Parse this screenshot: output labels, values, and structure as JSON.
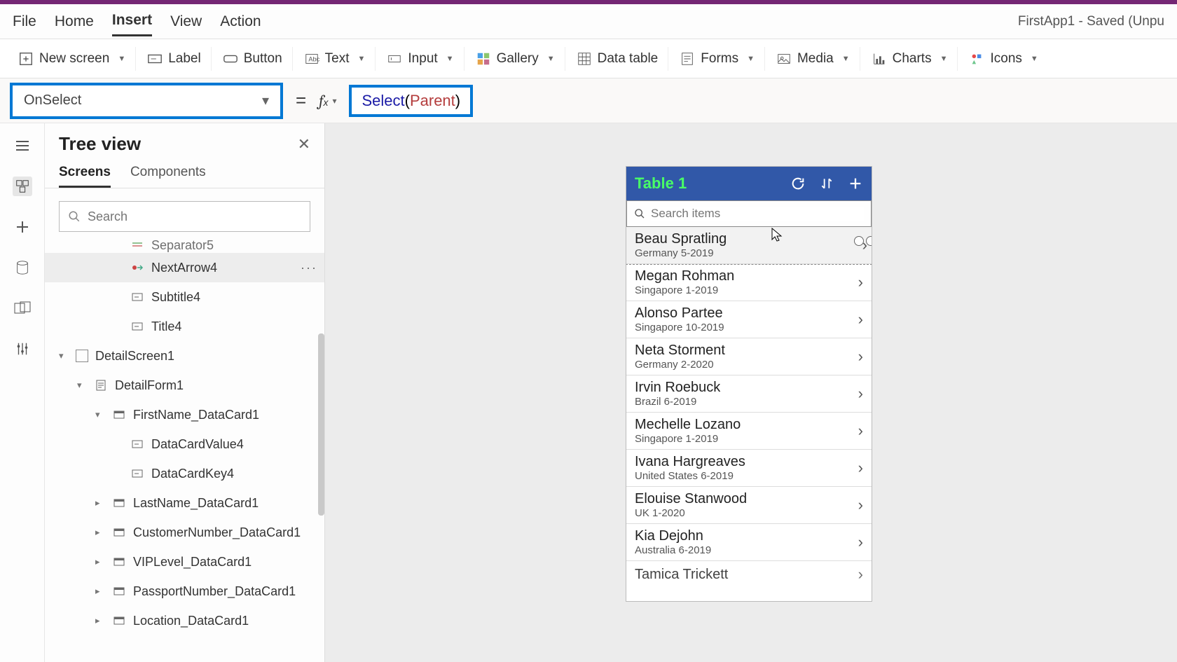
{
  "app_title": "FirstApp1 - Saved (Unpu",
  "menu": [
    "File",
    "Home",
    "Insert",
    "View",
    "Action"
  ],
  "active_menu": "Insert",
  "ribbon": [
    {
      "label": "New screen",
      "icon": "new-screen",
      "chevron": true
    },
    {
      "label": "Label",
      "icon": "label",
      "chevron": false
    },
    {
      "label": "Button",
      "icon": "button",
      "chevron": false
    },
    {
      "label": "Text",
      "icon": "text",
      "chevron": true
    },
    {
      "label": "Input",
      "icon": "input",
      "chevron": true
    },
    {
      "label": "Gallery",
      "icon": "gallery",
      "chevron": true
    },
    {
      "label": "Data table",
      "icon": "data-table",
      "chevron": false
    },
    {
      "label": "Forms",
      "icon": "forms",
      "chevron": true
    },
    {
      "label": "Media",
      "icon": "media",
      "chevron": true
    },
    {
      "label": "Charts",
      "icon": "charts",
      "chevron": true
    },
    {
      "label": "Icons",
      "icon": "icons",
      "chevron": true
    }
  ],
  "property_dropdown": "OnSelect",
  "formula": {
    "fn": "Select",
    "arg": "Parent"
  },
  "tree": {
    "title": "Tree view",
    "tabs": [
      "Screens",
      "Components"
    ],
    "active_tab": "Screens",
    "search_placeholder": "Search",
    "items": [
      {
        "depth": 3,
        "label": "Separator5",
        "expander": "",
        "icon": "sep",
        "selected": false,
        "cutoff": true
      },
      {
        "depth": 3,
        "label": "NextArrow4",
        "expander": "",
        "icon": "arrow",
        "selected": true,
        "more": true
      },
      {
        "depth": 3,
        "label": "Subtitle4",
        "expander": "",
        "icon": "label",
        "selected": false
      },
      {
        "depth": 3,
        "label": "Title4",
        "expander": "",
        "icon": "label",
        "selected": false
      },
      {
        "depth": 0,
        "label": "DetailScreen1",
        "expander": "▾",
        "icon": "screen",
        "selected": false
      },
      {
        "depth": 1,
        "label": "DetailForm1",
        "expander": "▾",
        "icon": "form",
        "selected": false
      },
      {
        "depth": 2,
        "label": "FirstName_DataCard1",
        "expander": "▾",
        "icon": "card",
        "selected": false
      },
      {
        "depth": 3,
        "label": "DataCardValue4",
        "expander": "",
        "icon": "label",
        "selected": false
      },
      {
        "depth": 3,
        "label": "DataCardKey4",
        "expander": "",
        "icon": "label",
        "selected": false
      },
      {
        "depth": 2,
        "label": "LastName_DataCard1",
        "expander": "▸",
        "icon": "card",
        "selected": false
      },
      {
        "depth": 2,
        "label": "CustomerNumber_DataCard1",
        "expander": "▸",
        "icon": "card",
        "selected": false
      },
      {
        "depth": 2,
        "label": "VIPLevel_DataCard1",
        "expander": "▸",
        "icon": "card",
        "selected": false
      },
      {
        "depth": 2,
        "label": "PassportNumber_DataCard1",
        "expander": "▸",
        "icon": "card",
        "selected": false
      },
      {
        "depth": 2,
        "label": "Location_DataCard1",
        "expander": "▸",
        "icon": "card",
        "selected": false
      }
    ]
  },
  "phone": {
    "title": "Table 1",
    "search_placeholder": "Search items",
    "items": [
      {
        "name": "Beau Spratling",
        "sub": "Germany 5-2019",
        "selected": true
      },
      {
        "name": "Megan Rohman",
        "sub": "Singapore 1-2019"
      },
      {
        "name": "Alonso Partee",
        "sub": "Singapore 10-2019"
      },
      {
        "name": "Neta Storment",
        "sub": "Germany 2-2020"
      },
      {
        "name": "Irvin Roebuck",
        "sub": "Brazil 6-2019"
      },
      {
        "name": "Mechelle Lozano",
        "sub": "Singapore 1-2019"
      },
      {
        "name": "Ivana Hargreaves",
        "sub": "United States 6-2019"
      },
      {
        "name": "Elouise Stanwood",
        "sub": "UK 1-2020"
      },
      {
        "name": "Kia Dejohn",
        "sub": "Australia 6-2019"
      },
      {
        "name": "Tamica Trickett",
        "sub": ""
      }
    ]
  }
}
